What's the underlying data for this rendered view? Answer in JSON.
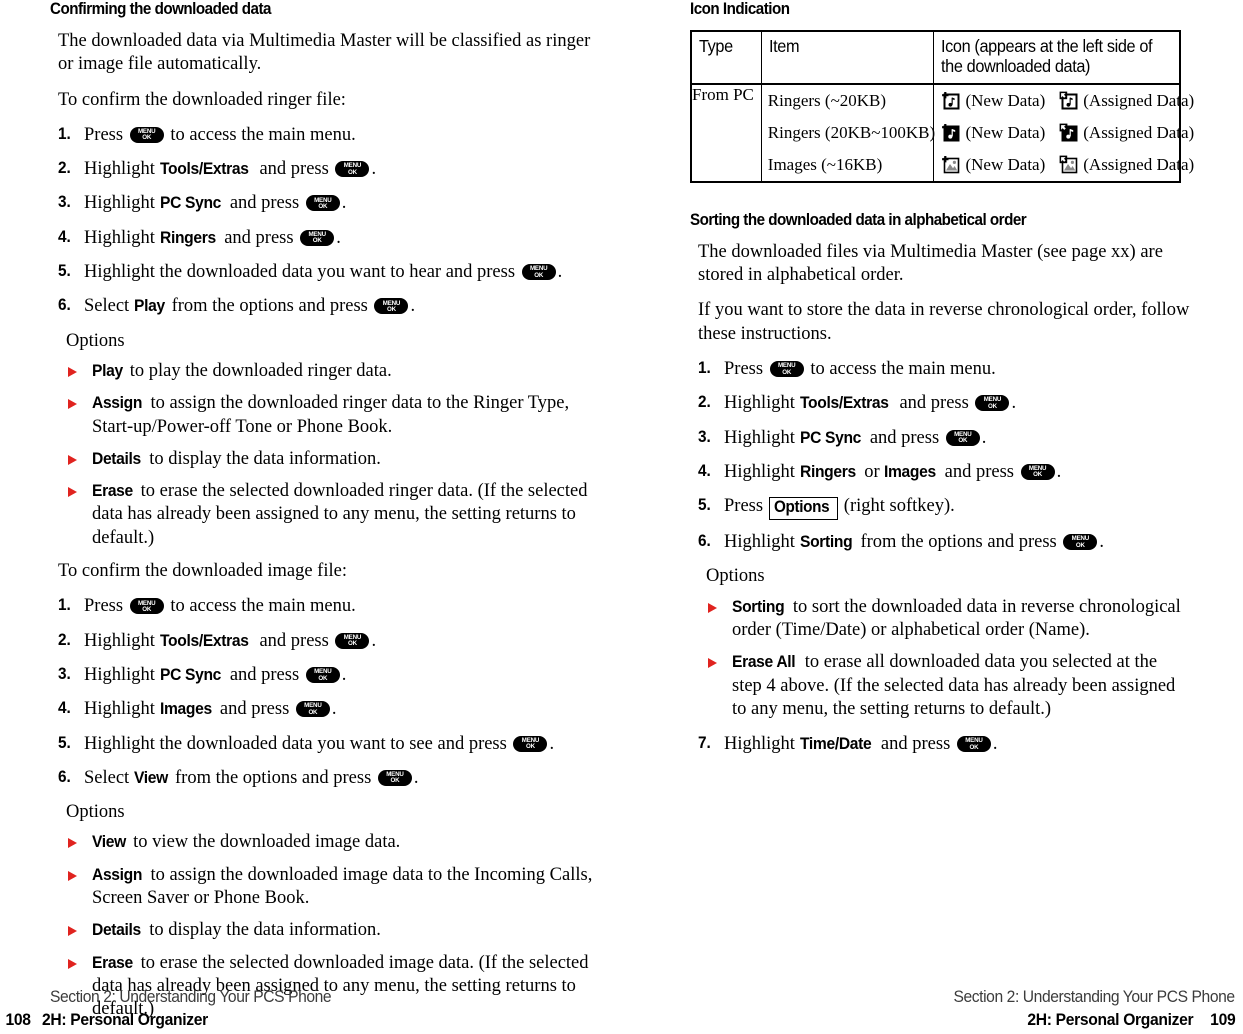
{
  "left_column": {
    "heading": "Confirming the downloaded data",
    "intro": "The downloaded data via Multimedia Master will be classified as ringer or image file automatically.",
    "ringer_lead": "To confirm the downloaded ringer file:",
    "ringer_steps": [
      {
        "num": "1.",
        "pre": "Press ",
        "key": true,
        "post": " to access the main menu."
      },
      {
        "num": "2.",
        "pre": "Highlight ",
        "bold": "Tools/Extras",
        "mid": " and press ",
        "key": true,
        "post": "."
      },
      {
        "num": "3.",
        "pre": "Highlight ",
        "bold": "PC Sync",
        "mid": " and press ",
        "key": true,
        "post": "."
      },
      {
        "num": "4.",
        "pre": "Highlight ",
        "bold": "Ringers",
        "mid": " and press ",
        "key": true,
        "post": "."
      },
      {
        "num": "5.",
        "pre": "Highlight the downloaded data you want to hear and press ",
        "key": true,
        "post": "."
      },
      {
        "num": "6.",
        "pre": "Select ",
        "bold": "Play",
        "mid": " from the options and press ",
        "key": true,
        "post": "."
      }
    ],
    "ringer_options_label": "Options",
    "ringer_options": [
      {
        "bold": "Play",
        "text": " to play the downloaded ringer data."
      },
      {
        "bold": "Assign",
        "text": " to assign the downloaded ringer data to the Ringer Type, Start-up/Power-off Tone or Phone Book."
      },
      {
        "bold": "Details",
        "text": " to display the data information."
      },
      {
        "bold": "Erase",
        "text": " to erase the selected downloaded ringer data. (If the selected data has already been assigned to any menu, the setting returns to default.)"
      }
    ],
    "image_lead": "To confirm the downloaded image file:",
    "image_steps": [
      {
        "num": "1.",
        "pre": "Press ",
        "key": true,
        "post": " to access the main menu."
      },
      {
        "num": "2.",
        "pre": "Highlight ",
        "bold": "Tools/Extras",
        "mid": " and press ",
        "key": true,
        "post": "."
      },
      {
        "num": "3.",
        "pre": "Highlight ",
        "bold": "PC Sync",
        "mid": " and press ",
        "key": true,
        "post": "."
      },
      {
        "num": "4.",
        "pre": "Highlight ",
        "bold": "Images",
        "mid": " and press ",
        "key": true,
        "post": "."
      },
      {
        "num": "5.",
        "pre": "Highlight the downloaded data you want to see and press ",
        "key": true,
        "post": "."
      },
      {
        "num": "6.",
        "pre": "Select ",
        "bold": "View",
        "mid": " from the options and press ",
        "key": true,
        "post": "."
      }
    ],
    "image_options_label": "Options",
    "image_options": [
      {
        "bold": "View",
        "text": " to view the downloaded image data."
      },
      {
        "bold": "Assign",
        "text": " to assign the downloaded image data to the Incoming Calls, Screen Saver or Phone Book."
      },
      {
        "bold": "Details",
        "text": " to display the data information."
      },
      {
        "bold": "Erase",
        "text": " to erase the selected downloaded image data. (If the selected data has already been assigned to any menu, the setting returns to default.)"
      }
    ]
  },
  "right_column": {
    "heading": "Icon Indication",
    "table": {
      "headers": [
        "Type",
        "Item",
        "Icon (appears at the left side of the downloaded data)"
      ],
      "type_value": "From PC",
      "rows": [
        {
          "item": "Ringers (~20KB)",
          "new_icon": "ringer-small-new-icon",
          "new_label": "(New Data)",
          "assigned_icon": "ringer-small-assigned-icon",
          "assigned_label": "(Assigned Data)"
        },
        {
          "item": "Ringers (20KB~100KB)",
          "new_icon": "ringer-large-new-icon",
          "new_label": "(New Data)",
          "assigned_icon": "ringer-large-assigned-icon",
          "assigned_label": "(Assigned Data)"
        },
        {
          "item": "Images (~16KB)",
          "new_icon": "image-new-icon",
          "new_label": "(New Data)",
          "assigned_icon": "image-assigned-icon",
          "assigned_label": "(Assigned Data)"
        }
      ]
    },
    "sort_heading": "Sorting the downloaded data in alphabetical order",
    "sort_para1": "The downloaded files via Multimedia Master (see page xx) are stored in alphabetical order.",
    "sort_para2": "If you want to store the data in reverse chronological order, follow these instructions.",
    "sort_steps": [
      {
        "num": "1.",
        "pre": "Press ",
        "key": true,
        "post": " to access the main menu."
      },
      {
        "num": "2.",
        "pre": "Highlight ",
        "bold": "Tools/Extras",
        "mid": " and press ",
        "key": true,
        "post": "."
      },
      {
        "num": "3.",
        "pre": "Highlight ",
        "bold": "PC Sync",
        "mid": " and press ",
        "key": true,
        "post": "."
      },
      {
        "num": "4.",
        "pre": "Highlight ",
        "bold": "Ringers",
        "mid2": " or ",
        "bold2": "Images",
        "mid": " and press ",
        "key": true,
        "post": "."
      },
      {
        "num": "5.",
        "pre": "Press ",
        "softkey": "Options",
        "post": " (right softkey)."
      },
      {
        "num": "6.",
        "pre": "Highlight ",
        "bold": "Sorting",
        "mid": " from the options and press ",
        "key": true,
        "post": "."
      }
    ],
    "options_label": "Options",
    "options": [
      {
        "bold": "Sorting",
        "text": " to sort the downloaded data in reverse chronological order (Time/Date) or alphabetical order (Name)."
      },
      {
        "bold": "Erase All",
        "text": " to erase all downloaded data you selected at the step 4 above. (If the selected data has already been assigned to any menu, the setting returns to default.)"
      }
    ],
    "final_step": {
      "num": "7.",
      "pre": "Highlight ",
      "bold": "Time/Date",
      "mid": " and press ",
      "key": true,
      "post": "."
    }
  },
  "key_button": {
    "line1": "MENU",
    "line2": "OK"
  },
  "footer_left": {
    "section": "Section 2: Understanding Your PCS Phone",
    "page": "108",
    "chapter": "2H: Personal Organizer"
  },
  "footer_right": {
    "section": "Section 2: Understanding Your PCS Phone",
    "chapter": "2H: Personal Organizer",
    "page": "109"
  },
  "colors": {
    "bullet_red": "#e0231f",
    "text": "#000000",
    "footer_gray": "#3c3c3c"
  }
}
